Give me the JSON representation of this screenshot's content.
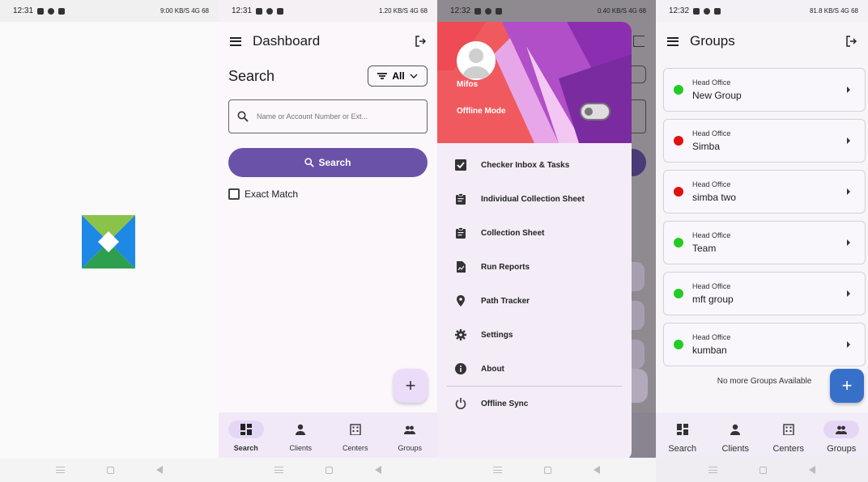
{
  "colors": {
    "primary": "#6a52a8",
    "fab_light": "#ebdcfa",
    "fab_blue": "#3770c8",
    "status_green": "#22cc22",
    "status_red": "#e11111"
  },
  "status_bars": [
    {
      "time": "12:31",
      "right": "9:00 KB/S 4G 68"
    },
    {
      "time": "12:31",
      "right": "1.20 KB/S 4G 68"
    },
    {
      "time": "12:32",
      "right": "0.40 KB/S 4G 68"
    },
    {
      "time": "12:32",
      "right": "81.8 KB/S 4G 68"
    }
  ],
  "splash": {
    "logo": "mifos-x-logo"
  },
  "dashboard": {
    "title": "Dashboard",
    "search_title": "Search",
    "filter_label": "All",
    "input_placeholder": "Name or Account Number or Ext...",
    "search_button": "Search",
    "exact_match": "Exact Match",
    "fab": "+"
  },
  "bottom_nav": [
    {
      "label": "Search",
      "icon": "dashboard-icon"
    },
    {
      "label": "Clients",
      "icon": "person-icon"
    },
    {
      "label": "Centers",
      "icon": "building-icon"
    },
    {
      "label": "Groups",
      "icon": "group-icon"
    }
  ],
  "drawer": {
    "user_name": "Mifos",
    "offline_mode": "Offline Mode",
    "items": [
      {
        "label": "Checker Inbox & Tasks",
        "icon": "checkbox-icon"
      },
      {
        "label": "Individual Collection Sheet",
        "icon": "clipboard-icon"
      },
      {
        "label": "Collection Sheet",
        "icon": "clipboard-icon"
      },
      {
        "label": "Run Reports",
        "icon": "report-icon"
      },
      {
        "label": "Path Tracker",
        "icon": "location-icon"
      },
      {
        "label": "Settings",
        "icon": "gear-icon"
      },
      {
        "label": "About",
        "icon": "info-icon"
      }
    ],
    "footer_item": {
      "label": "Offline Sync",
      "icon": "power-icon"
    }
  },
  "groups": {
    "title": "Groups",
    "items": [
      {
        "office": "Head Office",
        "name": "New Group",
        "status": "green"
      },
      {
        "office": "Head Office",
        "name": "Simba",
        "status": "red"
      },
      {
        "office": "Head Office",
        "name": "simba two",
        "status": "red"
      },
      {
        "office": "Head Office",
        "name": "Team",
        "status": "green"
      },
      {
        "office": "Head Office",
        "name": "mft group",
        "status": "green"
      },
      {
        "office": "Head Office",
        "name": "kumban",
        "status": "green"
      }
    ],
    "no_more": "No more Groups Available",
    "fab": "+"
  }
}
